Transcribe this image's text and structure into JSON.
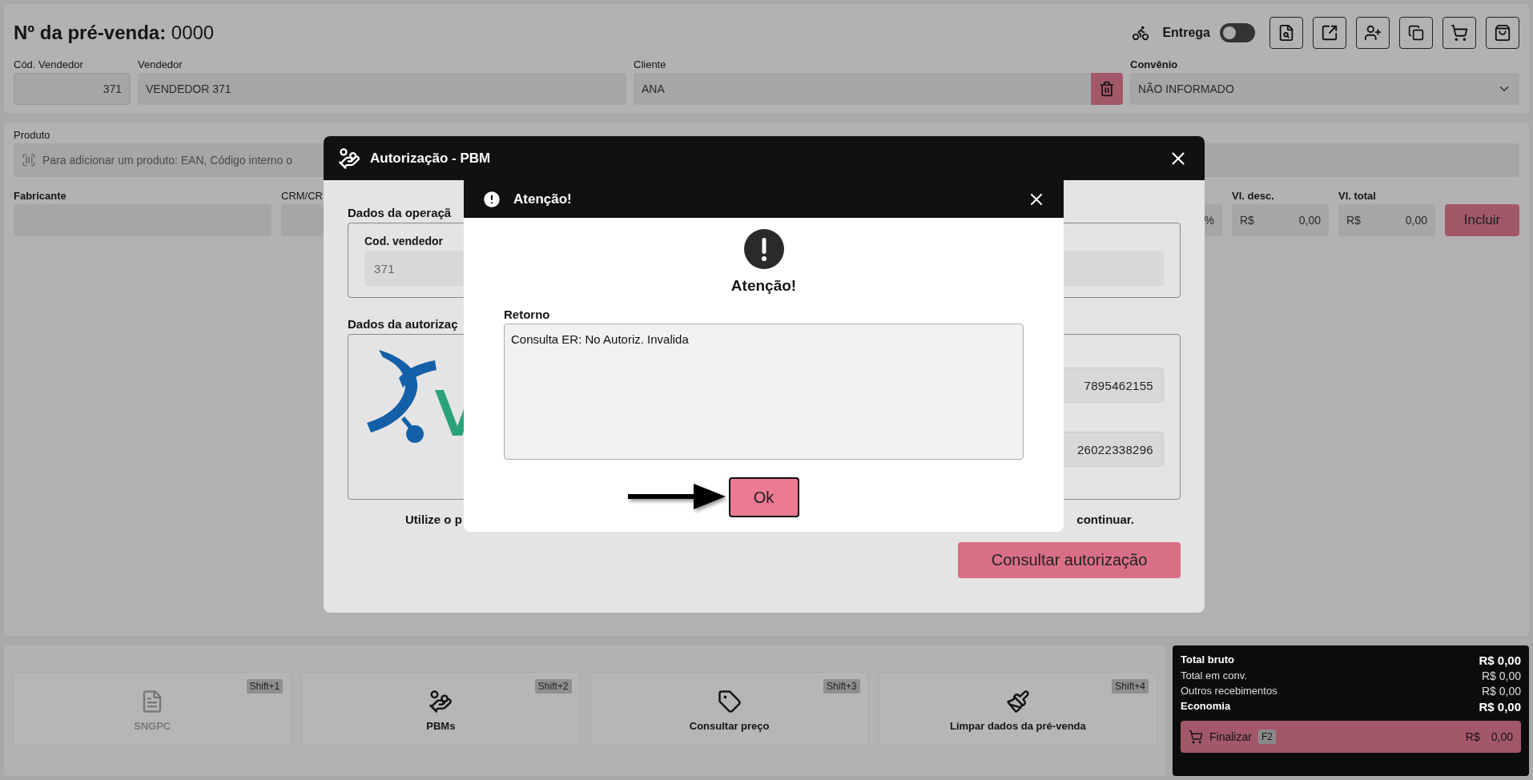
{
  "header": {
    "title": "**Nº da pré-venda:** 0000",
    "delivery": {
      "label": "Entrega",
      "on": false
    },
    "seller_code": {
      "label": "Cód. Vendedor",
      "value": "371"
    },
    "seller": {
      "label": "Vendedor",
      "value": "VENDEDOR 371"
    },
    "client": {
      "label": "Cliente",
      "value": "ANA"
    },
    "agreement": {
      "label": "Convênio",
      "value": "NÃO INFORMADO"
    }
  },
  "product": {
    "label": "Produto",
    "placeholder": "Para adicionar um produto: EAN, Código interno o",
    "manufacturer_label": "Fabricante",
    "crm_label": "CRM/CR",
    "percent": "%",
    "discount": {
      "label": "Vl. desc.",
      "currency": "R$",
      "value": "0,00"
    },
    "total": {
      "label": "Vl. total",
      "currency": "R$",
      "value": "0,00"
    },
    "add_button": "Incluir"
  },
  "actions": [
    {
      "kind": "document",
      "label": "SNGPC",
      "shortcut": "Shift+1",
      "disabled": true
    },
    {
      "kind": "hand",
      "label": "PBMs",
      "shortcut": "Shift+2",
      "disabled": false
    },
    {
      "kind": "tag",
      "label": "Consultar preço",
      "shortcut": "Shift+3",
      "disabled": false
    },
    {
      "kind": "brush",
      "label": "Limpar dados da pré-venda",
      "shortcut": "Shift+4",
      "disabled": false
    }
  ],
  "totals": {
    "rows": [
      {
        "label": "Total bruto",
        "value": "R$ 0,00",
        "emphasis": true
      },
      {
        "label": "Total em conv.",
        "value": "R$ 0,00",
        "emphasis": false
      },
      {
        "label": "Outros recebimentos",
        "value": "R$ 0,00",
        "emphasis": false
      },
      {
        "label": "Economia",
        "value": "R$ 0,00",
        "emphasis": true
      }
    ],
    "finish": {
      "label": "Finalizar",
      "shortcut": "F2",
      "currency": "R$",
      "value": "0,00"
    }
  },
  "pbm_dialog": {
    "title": "Autorização - PBM",
    "operation_heading": "Dados da operaçã",
    "seller_code_label": "Cod. vendedor",
    "seller_code": "371",
    "authorization_heading": "Dados da autorizaç",
    "values": [
      "7895462155",
      "26022338296"
    ],
    "hint_start": "Utilize o p",
    "hint_end": "continuar.",
    "button": "Consultar autorização"
  },
  "alert": {
    "title": "Atenção!",
    "heading": "Atenção!",
    "field_label": "Retorno",
    "field_value": "Consulta ER: No Autoriz. Invalida",
    "button": "Ok"
  }
}
